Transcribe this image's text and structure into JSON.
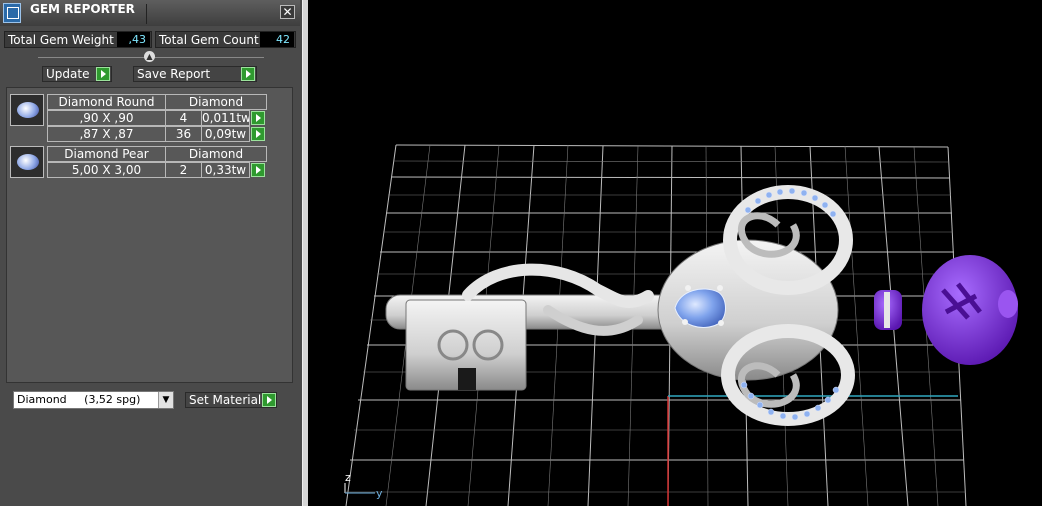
{
  "window": {
    "title": "GEM REPORTER",
    "close_glyph": "✕"
  },
  "totals": {
    "weight_label": "Total Gem Weight",
    "weight_value": ",43",
    "count_label": "Total Gem Count",
    "count_value": "42"
  },
  "buttons": {
    "update": "Update",
    "save_report": "Save Report",
    "set_material": "Set Material"
  },
  "gems": [
    {
      "name": "Diamond Round",
      "material": "Diamond",
      "icon": "round-gem-icon",
      "rows": [
        {
          "size": ",90 X ,90",
          "count": "4",
          "weight": "0,011tw"
        },
        {
          "size": ",87 X ,87",
          "count": "36",
          "weight": "0,09tw"
        }
      ]
    },
    {
      "name": "Diamond Pear",
      "material": "Diamond",
      "icon": "pear-gem-icon",
      "rows": [
        {
          "size": "5,00 X 3,00",
          "count": "2",
          "weight": "0,33tw"
        }
      ]
    }
  ],
  "material_select": {
    "value": "Diamond     (3,52 spg)"
  },
  "viewport": {
    "axis_z": "z",
    "axis_y": "y",
    "background": "#000000",
    "grid_color": "#bfbfbf",
    "metal_color": "#d9d9d9",
    "accent_purple": "#7b2fd6",
    "gem_blue": "#8fb2f0"
  }
}
